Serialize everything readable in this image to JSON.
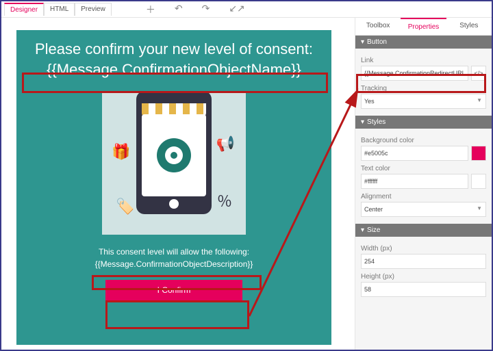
{
  "mode_tabs": {
    "designer": "Designer",
    "html": "HTML",
    "preview": "Preview"
  },
  "canvas": {
    "heading": "Please confirm your new level of consent:",
    "token_name": "{{Message.ConfirmationObjectName}}",
    "legend": "This consent level will allow the following:",
    "token_desc": "{{Message.ConfirmationObjectDescription}}",
    "confirm_label": "I Confirm"
  },
  "side": {
    "tabs": {
      "toolbox": "Toolbox",
      "properties": "Properties",
      "styles": "Styles"
    },
    "button_section": {
      "title": "Button",
      "link_label": "Link",
      "link_value": "{{Message.ConfirmationRedirectURL}}",
      "code_btn": "</>",
      "tracking_label": "Tracking",
      "tracking_value": "Yes"
    },
    "styles_section": {
      "title": "Styles",
      "bg_label": "Background color",
      "bg_value": "#e5005c",
      "bg_swatch": "#e5005c",
      "text_label": "Text color",
      "text_value": "#ffffff",
      "text_swatch": "#ffffff",
      "align_label": "Alignment",
      "align_value": "Center"
    },
    "size_section": {
      "title": "Size",
      "width_label": "Width (px)",
      "width_value": "254",
      "height_label": "Height (px)",
      "height_value": "58"
    }
  }
}
